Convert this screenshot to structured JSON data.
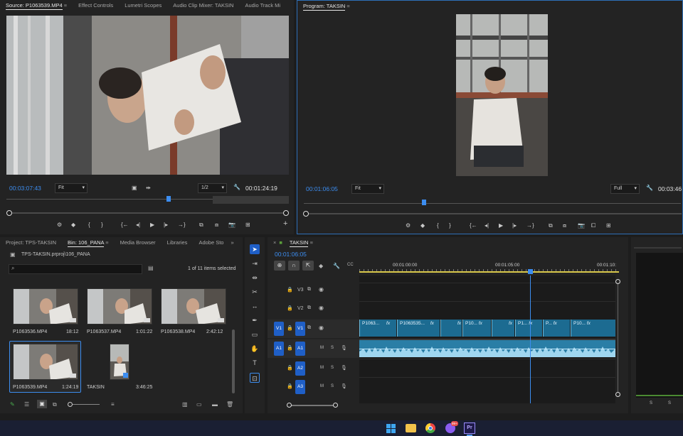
{
  "source_panel": {
    "tabs": [
      {
        "label": "Source: P1063539.MP4",
        "active": true
      },
      {
        "label": "Effect Controls"
      },
      {
        "label": "Lumetri Scopes"
      },
      {
        "label": "Audio Clip Mixer: TAKSIN"
      },
      {
        "label": "Audio Track Mi"
      }
    ],
    "timecode": "00:03:07:43",
    "zoom": "Fit",
    "resolution": "1/2",
    "duration": "00:01:24:19"
  },
  "program_panel": {
    "title": "Program: TAKSIN",
    "timecode": "00:01:06:05",
    "zoom": "Fit",
    "resolution": "Full",
    "duration": "00:03:46"
  },
  "transport_glyphs": {
    "mark_in": "{",
    "mark_out": "}",
    "go_in": "{←",
    "step_back": "◂|",
    "play": "▶",
    "step_fwd": "|▸",
    "go_out": "→}",
    "add": "+"
  },
  "project_panel": {
    "tabs": [
      {
        "label": "Project: TPS-TAKSIN"
      },
      {
        "label": "Bin: 106_PANA",
        "active": true
      },
      {
        "label": "Media Browser"
      },
      {
        "label": "Libraries"
      },
      {
        "label": "Adobe Sto"
      }
    ],
    "path": "TPS-TAKSIN.prproj\\106_PANA",
    "search_placeholder": "",
    "selection_count": "1 of 11 items selected",
    "items": [
      {
        "name": "P1063536.MP4",
        "duration": "18:12"
      },
      {
        "name": "P1063537.MP4",
        "duration": "1:01:22"
      },
      {
        "name": "P1063538.MP4",
        "duration": "2:42:12"
      },
      {
        "name": "P1063539.MP4",
        "duration": "1:24:19",
        "selected": true
      },
      {
        "name": "TAKSIN",
        "duration": "3:46:25"
      }
    ]
  },
  "timeline": {
    "sequence": "TAKSIN",
    "timecode": "00:01:06:05",
    "ruler": [
      "00:01:00:00",
      "00:01:05:00",
      "00:01:10:"
    ],
    "tracks": [
      {
        "id": "V3",
        "type": "video"
      },
      {
        "id": "V2",
        "type": "video"
      },
      {
        "id": "V1",
        "type": "video",
        "source": "V1"
      },
      {
        "id": "A1",
        "type": "audio",
        "source": "A1"
      },
      {
        "id": "A2",
        "type": "audio"
      },
      {
        "id": "A3",
        "type": "audio"
      }
    ],
    "track_buttons": {
      "mute": "M",
      "solo": "S"
    },
    "fx_label": "fx",
    "clips": [
      {
        "label": "P1063..."
      },
      {
        "label": "P1063535..."
      },
      {
        "label": "P10..."
      },
      {
        "label": "P1..."
      },
      {
        "label": "P..."
      },
      {
        "label": "P10..."
      }
    ]
  },
  "meter": {
    "labels": [
      "S",
      "S"
    ]
  },
  "taskbar": {
    "badge": "99+",
    "app": "Pr"
  },
  "colors": {
    "accent": "#3c8df0",
    "video_clip": "#1c6b91",
    "audio_clip": "#2a7ea6",
    "track_target": "#1f5fc7"
  }
}
